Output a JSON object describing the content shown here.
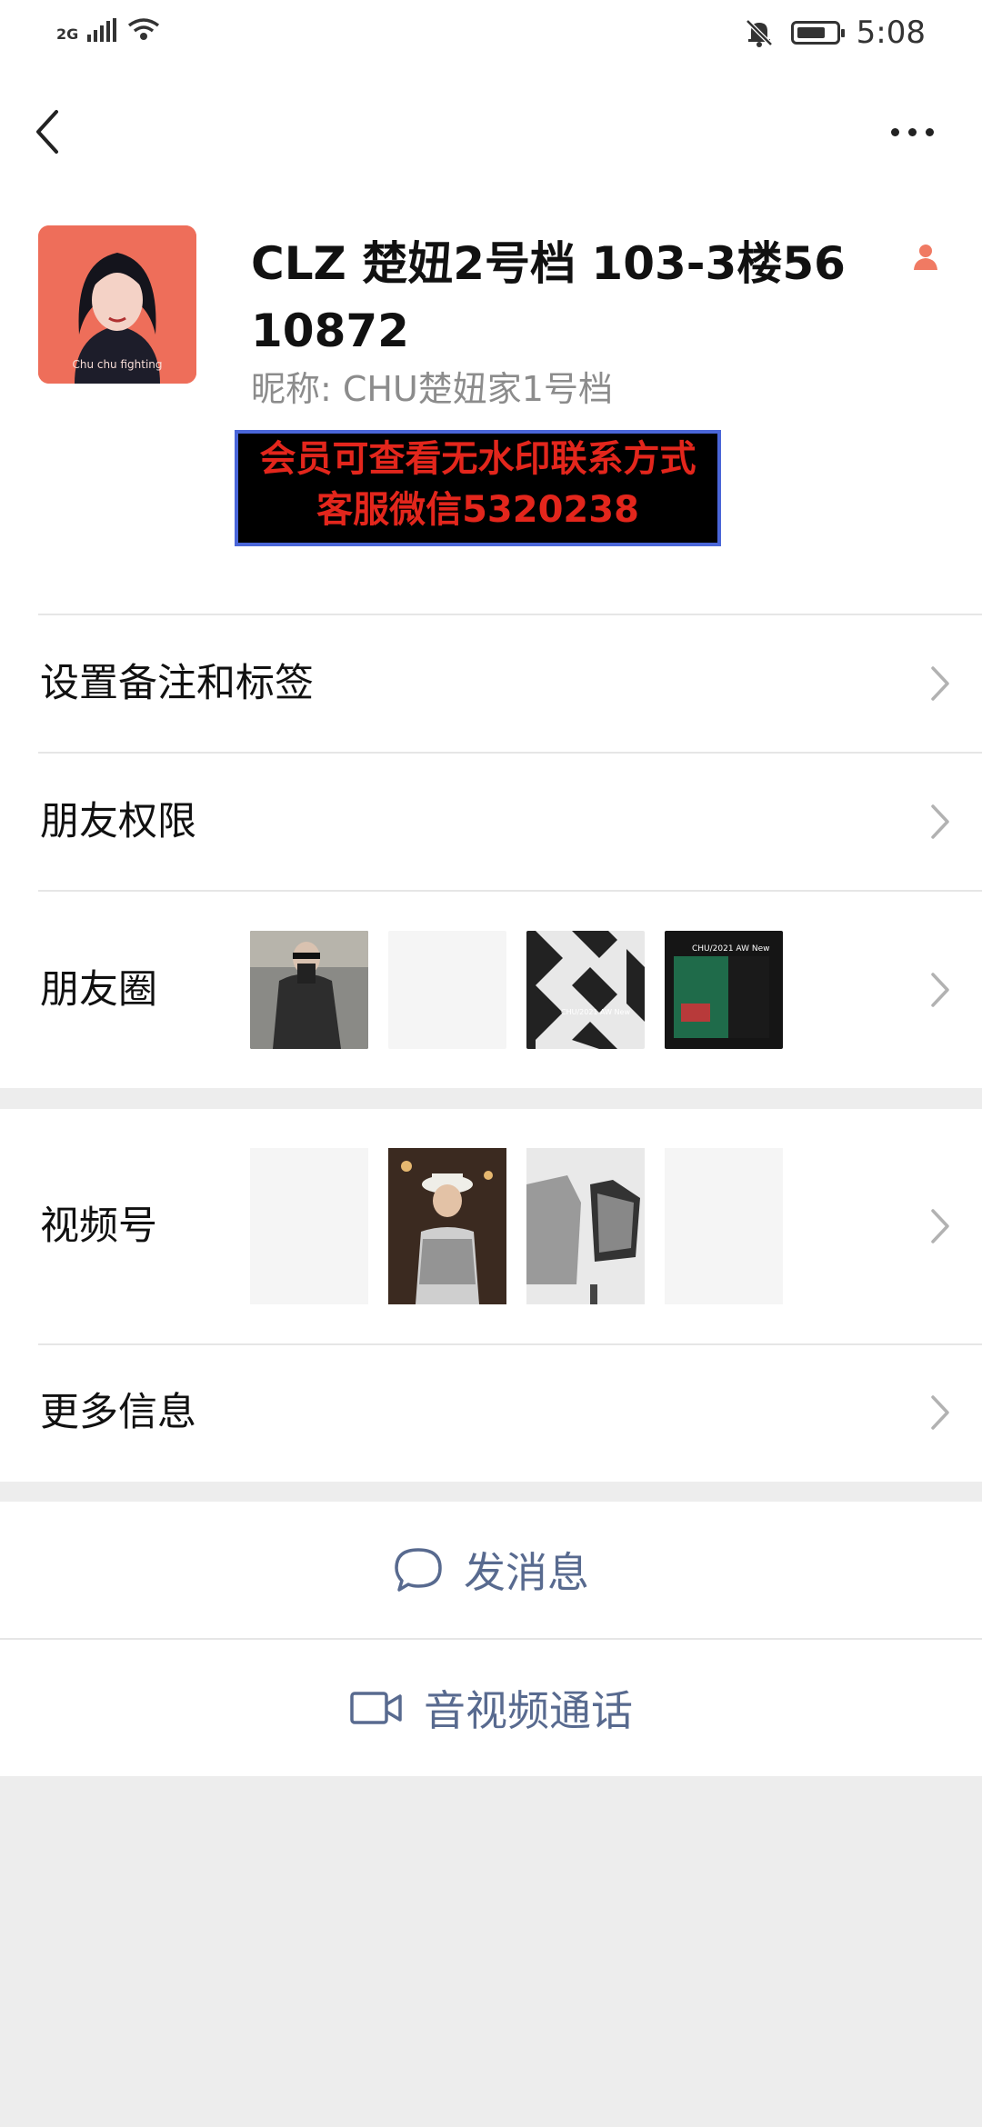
{
  "status_bar": {
    "network": "2G",
    "time": "5:08",
    "icons": [
      "signal-icon",
      "wifi-icon",
      "mute-bell-icon",
      "battery-icon"
    ]
  },
  "nav": {
    "back_icon": "chevron-left-icon",
    "more_icon": "ellipsis-icon"
  },
  "profile": {
    "avatar_caption": "Chu chu fighting",
    "name": "CLZ 楚妞2号档 103-3楼56 10872",
    "nickname": "昵称:  CHU楚妞家1号档",
    "gender_icon": "female-person-icon",
    "watermark_line1": "会员可查看无水印联系方式",
    "watermark_line2": "客服微信5320238"
  },
  "menu": {
    "remark": "设置备注和标签",
    "permissions": "朋友权限",
    "moments": "朋友圈",
    "channels": "视频号",
    "more_info": "更多信息",
    "moments_thumb_2_caption": "CHU/2021 AW New",
    "moments_thumb_3_caption": "CHU/2021 AW New"
  },
  "actions": {
    "message": "发消息",
    "video_call": "音视频通话"
  },
  "colors": {
    "accent_text": "#586a8f",
    "background": "#ededed",
    "watermark_red": "#e3261c",
    "gender_icon": "#f07a63"
  }
}
